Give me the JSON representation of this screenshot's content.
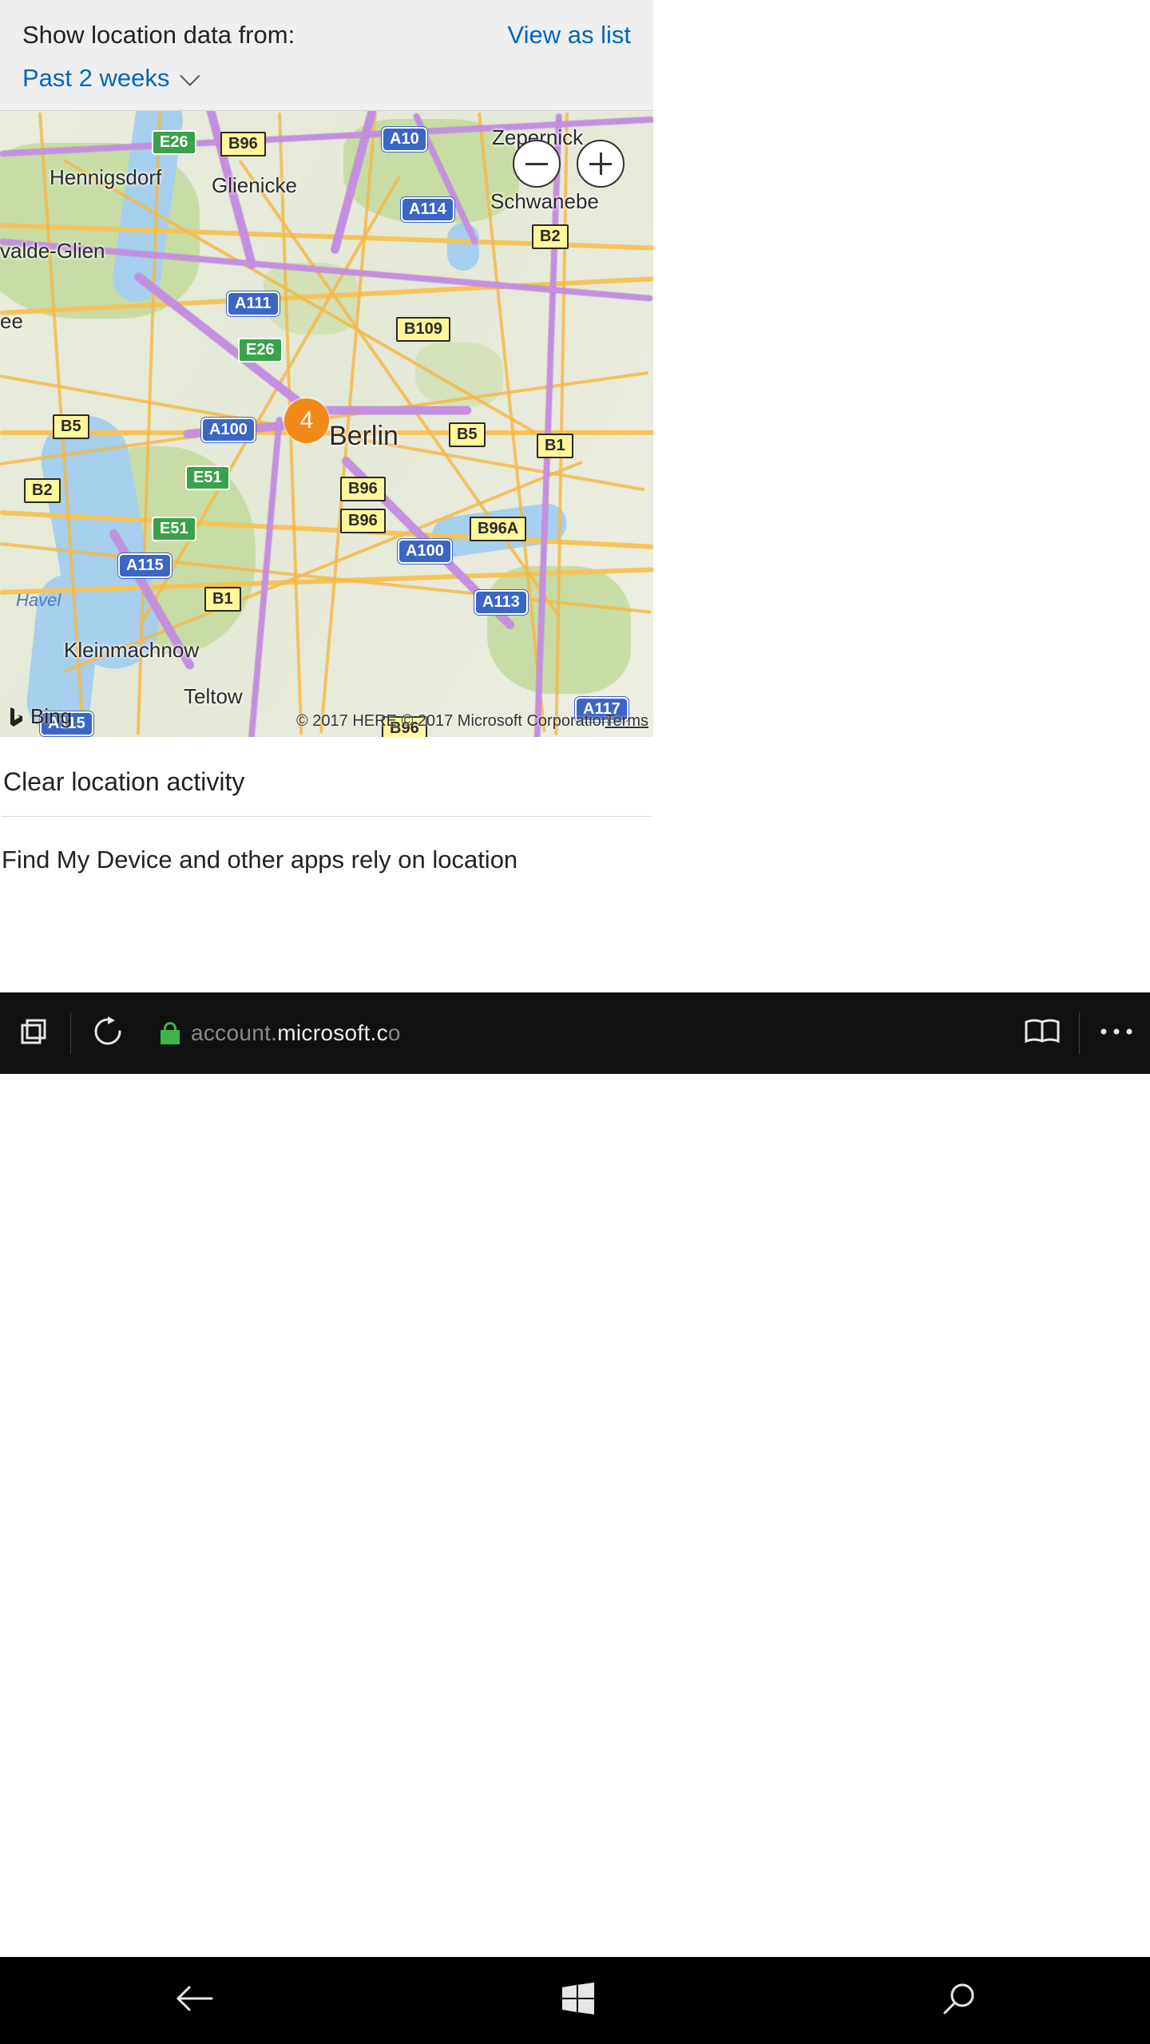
{
  "header": {
    "show_label": "Show location data from:",
    "view_as_list": "View as list",
    "range_selected": "Past 2 weeks"
  },
  "map": {
    "center_city": "Berlin",
    "cluster_count": "4",
    "cities": {
      "hennigsdorf": "Hennigsdorf",
      "glienicke": "Glienicke",
      "zepernick": "Zepernick",
      "schwanebe": "Schwanebe",
      "valde_glien": "valde-Glien",
      "ee": "ee",
      "kleinmachnow": "Kleinmachnow",
      "teltow": "Teltow",
      "havel": "Havel"
    },
    "shields": {
      "e26a": "E26",
      "e26b": "E26",
      "e51a": "E51",
      "e51b": "E51",
      "a10": "A10",
      "a114": "A114",
      "a111": "A111",
      "a100a": "A100",
      "a100b": "A100",
      "a115a": "A115",
      "a115b": "A115",
      "a113": "A113",
      "a117": "A117",
      "b96a": "B96",
      "b109": "B109",
      "b5a": "B5",
      "b5b": "B5",
      "b2a": "B2",
      "b2b": "B2",
      "b1a": "B1",
      "b1b": "B1",
      "b96b": "B96",
      "b96c": "B96",
      "b96d": "B96",
      "b96aa": "B96A"
    },
    "bing": "Bing",
    "attribution": "© 2017 HERE,© 2017 Microsoft Corporation",
    "terms": "Terms"
  },
  "actions": {
    "clear": "Clear location activity",
    "info": "Find My Device and other apps rely on location"
  },
  "browser": {
    "url_dim1": "account.",
    "url_bright": "microsoft.c",
    "url_dim2": "o"
  }
}
